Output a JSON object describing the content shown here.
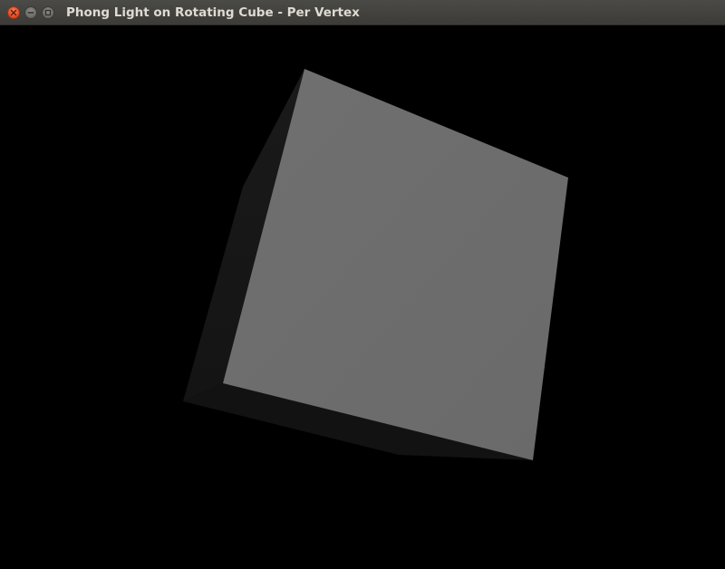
{
  "window": {
    "title": "Phong Light on Rotating Cube - Per Vertex",
    "controls": {
      "close_icon": "close-icon",
      "minimize_icon": "minimize-icon",
      "maximize_icon": "maximize-icon"
    }
  },
  "scene": {
    "background": "#000000",
    "cube": {
      "front_face_color": "#6e6e6e",
      "left_face_color": "#161616",
      "bottom_face_color": "#121212"
    }
  }
}
